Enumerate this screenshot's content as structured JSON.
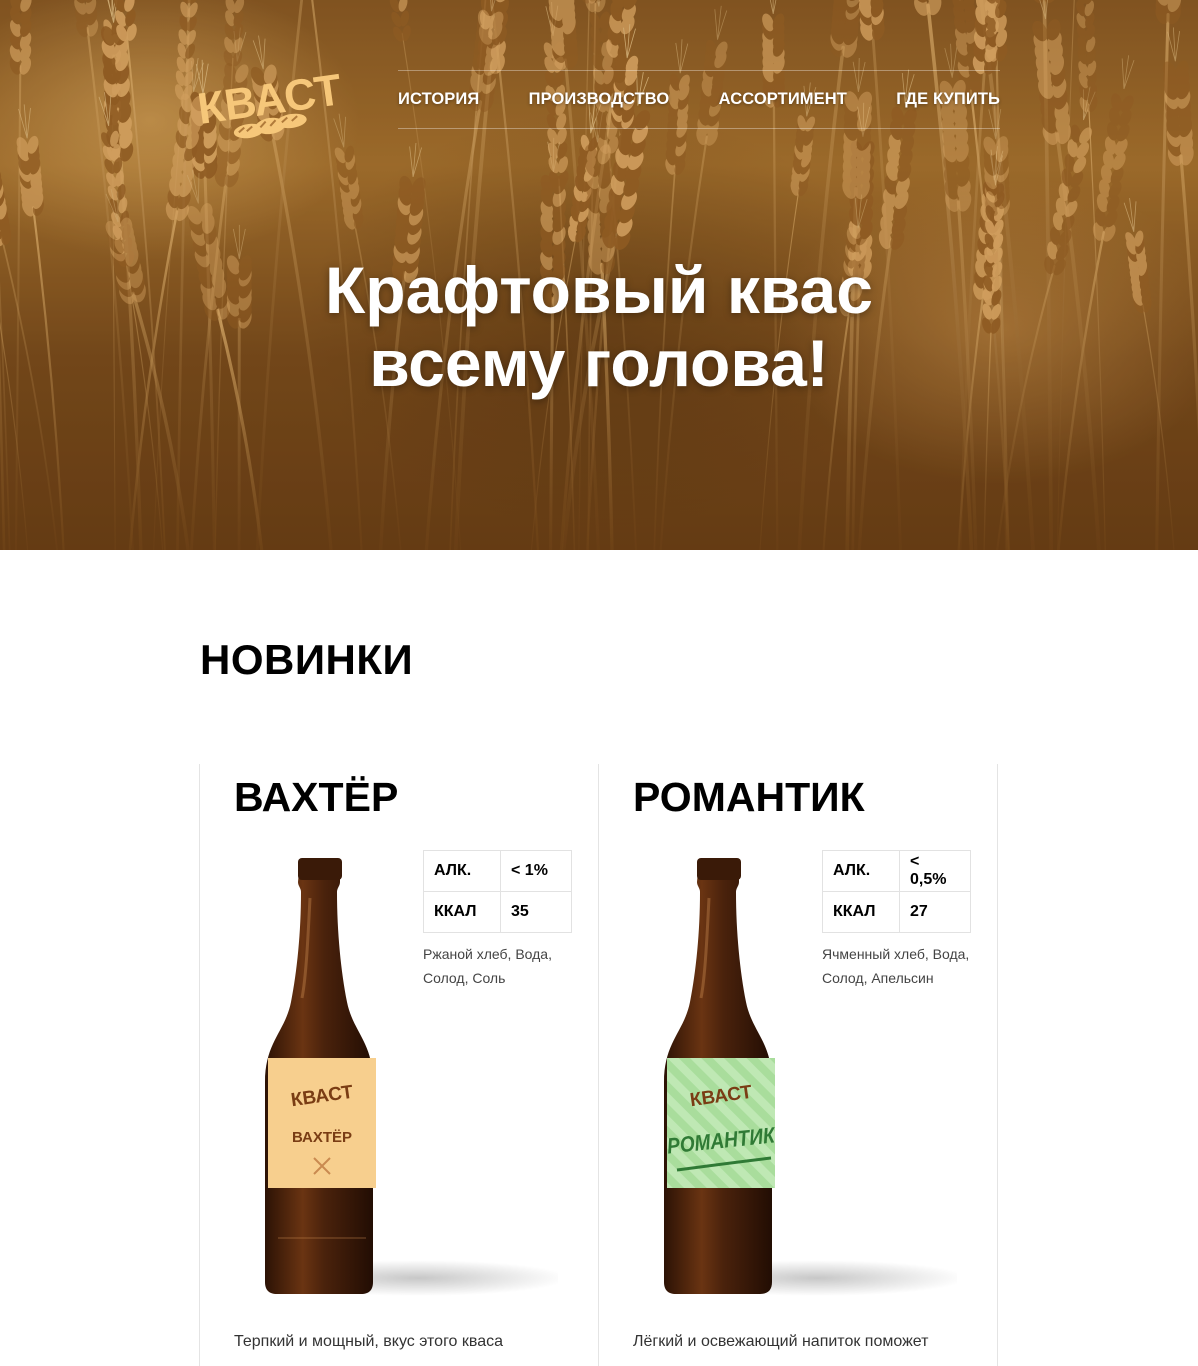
{
  "brand": {
    "logo_text": "КВАСТ",
    "logo_icon": "bread-loaves-icon"
  },
  "nav": {
    "items": [
      {
        "label": "ИСТОРИЯ"
      },
      {
        "label": "ПРОИЗВОДСТВО"
      },
      {
        "label": "АССОРТИМЕНТ"
      },
      {
        "label": "ГДЕ КУПИТЬ"
      }
    ]
  },
  "hero": {
    "title_line1": "Крафтовый квас",
    "title_line2": "всему голова!"
  },
  "new_section": {
    "title": "НОВИНКИ"
  },
  "products": [
    {
      "name": "ВАХТЁР",
      "alc_label": "АЛК.",
      "alc_value": "< 1%",
      "kcal_label": "ККАЛ",
      "kcal_value": "35",
      "ingredients": "Ржаной хлеб, Вода, Солод, Соль",
      "label_brand": "КВАСТ",
      "label_name": "ВАХТЁР",
      "label_color": "#f7cf8e",
      "description": "Терпкий и мощный, вкус этого кваса"
    },
    {
      "name": "РОМАНТИК",
      "alc_label": "АЛК.",
      "alc_value": "< 0,5%",
      "kcal_label": "ККАЛ",
      "kcal_value": "27",
      "ingredients": "Ячменный хлеб, Вода, Солод, Апельсин",
      "label_brand": "КВАСТ",
      "label_name": "РОМАНТИК",
      "label_color": "#bfe8b4",
      "description": "Лёгкий и освежающий напиток поможет"
    }
  ],
  "colors": {
    "logo": "#f6c77a",
    "bottle": "#4a220c",
    "text": "#000000"
  }
}
